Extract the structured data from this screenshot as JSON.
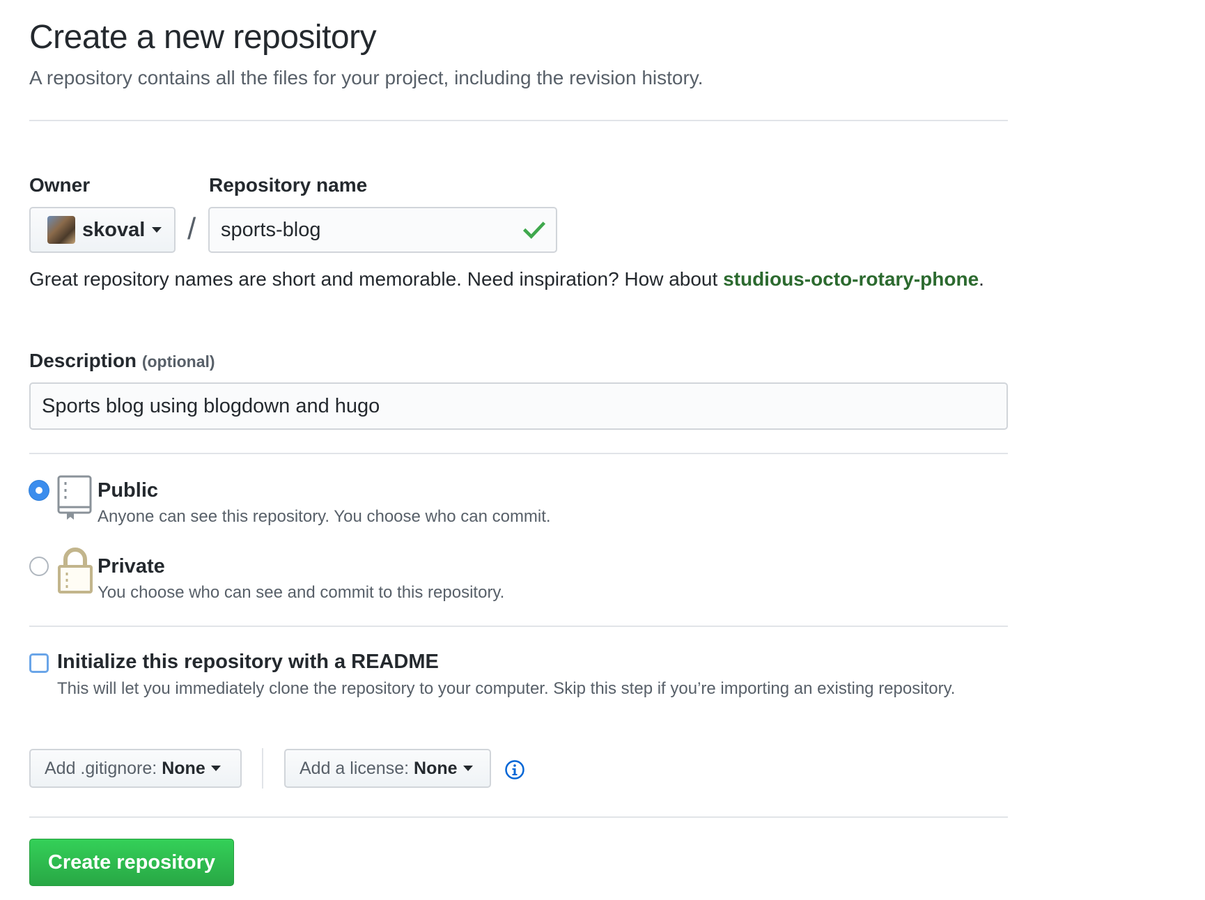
{
  "header": {
    "title": "Create a new repository",
    "subtitle": "A repository contains all the files for your project, including the revision history."
  },
  "owner": {
    "label": "Owner",
    "value": "skoval",
    "avatar_icon": "user-avatar"
  },
  "separator": "/",
  "repo_name": {
    "label": "Repository name",
    "value": "sports-blog",
    "status_icon": "check-icon",
    "status_color": "#28a745"
  },
  "hint": {
    "prefix": "Great repository names are short and memorable. Need inspiration? How about ",
    "suggestion": "studious-octo-rotary-phone",
    "suffix": "."
  },
  "description": {
    "label": "Description",
    "optional": "(optional)",
    "value": "Sports blog using blogdown and hugo"
  },
  "visibility": {
    "options": [
      {
        "title": "Public",
        "description": "Anyone can see this repository. You choose who can commit.",
        "icon": "repo-book-icon",
        "selected": true
      },
      {
        "title": "Private",
        "description": "You choose who can see and commit to this repository.",
        "icon": "lock-icon",
        "selected": false
      }
    ]
  },
  "readme": {
    "title": "Initialize this repository with a README",
    "description": "This will let you immediately clone the repository to your computer. Skip this step if you’re importing an existing repository.",
    "checked": false
  },
  "gitignore": {
    "label": "Add .gitignore:",
    "value": "None"
  },
  "license": {
    "label": "Add a license:",
    "value": "None"
  },
  "info_icon": "info-icon",
  "submit": {
    "label": "Create repository",
    "color": "#2cbe4e"
  }
}
